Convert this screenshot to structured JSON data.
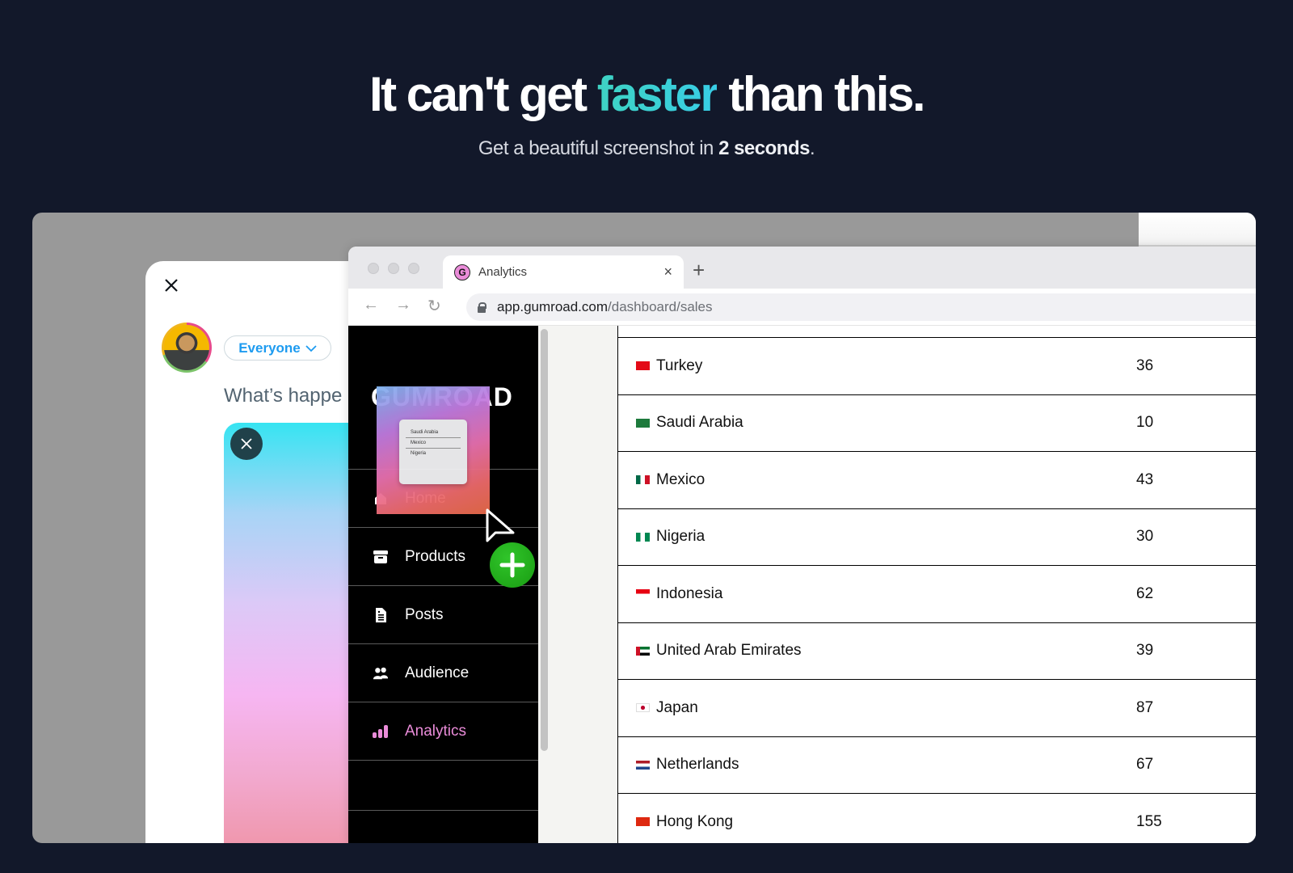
{
  "hero": {
    "title_before": "It can't get ",
    "title_accent": "faster",
    "title_after": " than this.",
    "subtitle_before": "Get a beautiful screenshot in ",
    "subtitle_bold": "2 seconds",
    "subtitle_after": ".",
    "accent_color": "#3ed3c3"
  },
  "composer": {
    "close_icon": "close-icon",
    "audience_label": "Everyone",
    "placeholder": "What’s happe",
    "media_remove_icon": "close-icon"
  },
  "browser": {
    "tab_title": "Analytics",
    "favicon_letter": "G",
    "tab_close": "×",
    "new_tab": "+",
    "nav_back": "←",
    "nav_forward": "→",
    "nav_reload": "↻",
    "url_host": "app.gumroad.com",
    "url_path": "/dashboard/sales"
  },
  "sidebar": {
    "logo": "GUMROAD",
    "items": [
      {
        "label": "Home",
        "icon": "home-icon"
      },
      {
        "label": "Products",
        "icon": "archive-box-icon"
      },
      {
        "label": "Posts",
        "icon": "document-icon"
      },
      {
        "label": "Audience",
        "icon": "people-icon"
      },
      {
        "label": "Analytics",
        "icon": "bar-chart-icon",
        "active": true
      }
    ],
    "active_color": "#ea8cd9"
  },
  "drag_preview": {
    "items": [
      "Saudi Arabia",
      "Mexico",
      "Nigeria"
    ]
  },
  "table": {
    "rows": [
      {
        "country": "Turkey",
        "flag": "TR",
        "value": "36"
      },
      {
        "country": "Saudi Arabia",
        "flag": "SA",
        "value": "10"
      },
      {
        "country": "Mexico",
        "flag": "MX",
        "value": "43"
      },
      {
        "country": "Nigeria",
        "flag": "NG",
        "value": "30"
      },
      {
        "country": "Indonesia",
        "flag": "ID",
        "value": "62"
      },
      {
        "country": "United Arab Emirates",
        "flag": "AE",
        "value": "39"
      },
      {
        "country": "Japan",
        "flag": "JP",
        "value": "87"
      },
      {
        "country": "Netherlands",
        "flag": "NL",
        "value": "67"
      },
      {
        "country": "Hong Kong",
        "flag": "HK",
        "value": "155"
      }
    ]
  }
}
